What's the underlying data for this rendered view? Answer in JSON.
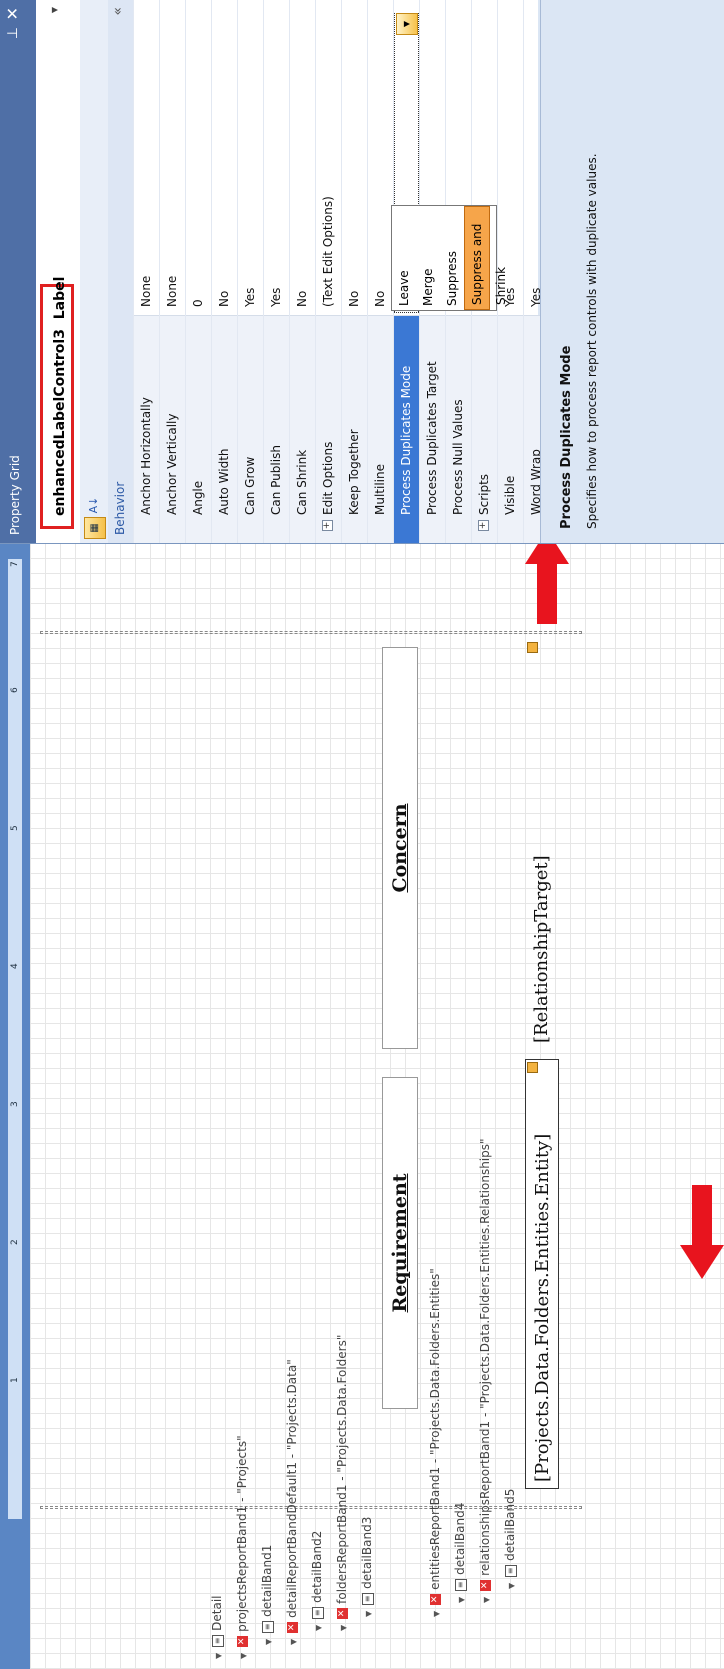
{
  "property_grid": {
    "title": "Property Grid",
    "pin_icon": "pin-icon",
    "close_icon": "close-icon",
    "object_name": "enhancedLabelControl3",
    "object_type": "Label",
    "category": "Behavior",
    "rows": [
      {
        "label": "Anchor Horizontally",
        "value": "None"
      },
      {
        "label": "Anchor Vertically",
        "value": "None"
      },
      {
        "label": "Angle",
        "value": "0"
      },
      {
        "label": "Auto Width",
        "value": "No"
      },
      {
        "label": "Can Grow",
        "value": "Yes"
      },
      {
        "label": "Can Publish",
        "value": "Yes"
      },
      {
        "label": "Can Shrink",
        "value": "No"
      },
      {
        "label": "Edit Options",
        "value": "(Text Edit Options)"
      },
      {
        "label": "Keep Together",
        "value": "No"
      },
      {
        "label": "Multiline",
        "value": "No"
      },
      {
        "label": "Process Duplicates Mode",
        "value": "Leave"
      },
      {
        "label": "Process Duplicates Target",
        "value": ""
      },
      {
        "label": "Process Null Values",
        "value": ""
      },
      {
        "label": "Scripts",
        "value": ""
      },
      {
        "label": "Visible",
        "value": "Yes"
      },
      {
        "label": "Word Wrap",
        "value": "Yes"
      }
    ],
    "dropdown_options": [
      "Leave",
      "Merge",
      "Suppress",
      "Suppress and Shrink"
    ],
    "dropdown_highlighted": "Suppress and Shrink",
    "description_title": "Process Duplicates Mode",
    "description_text": "Specifies how to process report controls with duplicate values."
  },
  "designer": {
    "ruler_ticks": [
      "1",
      "2",
      "3",
      "4",
      "5",
      "6",
      "7"
    ],
    "bands": [
      {
        "label": "Detail"
      },
      {
        "label": "projectsReportBand1 - \"Projects\""
      },
      {
        "label": "detailBand1"
      },
      {
        "label": "detailReportBandDefault1 - \"Projects.Data\""
      },
      {
        "label": "detailBand2"
      },
      {
        "label": "foldersReportBand1 - \"Projects.Data.Folders\""
      },
      {
        "label": "detailBand3"
      },
      {
        "label": "entitiesReportBand1 - \"Projects.Data.Folders.Entities\""
      },
      {
        "label": "detailBand4"
      },
      {
        "label": "relationshipsReportBand1 - \"Projects.Data.Folders.Entities.Relationships\""
      },
      {
        "label": "detailBand5"
      }
    ],
    "header_requirement": "Requirement",
    "header_concern": "Concern",
    "field_entity": "[Projects.Data.Folders.Entities.Entity]",
    "field_target": "[RelationshipTarget]"
  },
  "colors": {
    "accent_red": "#e8141e",
    "panel_title": "#4f6fa6",
    "selected_row": "#3b78d4",
    "dropdown_highlight": "#f6a54a"
  }
}
